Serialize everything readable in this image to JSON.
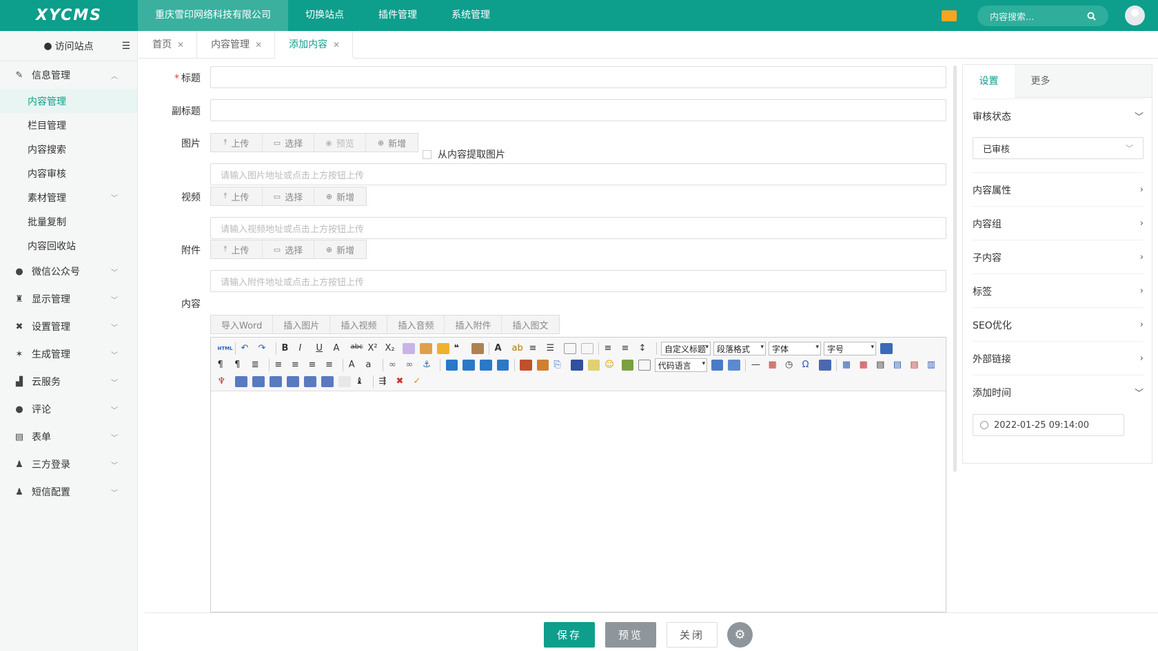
{
  "header": {
    "logo": "XYCMS",
    "nav": [
      "重庆雪印网络科技有限公司",
      "切换站点",
      "插件管理",
      "系统管理"
    ],
    "search_placeholder": "内容搜索...",
    "search_icon": "search-icon"
  },
  "sidebar": {
    "visit": "访问站点",
    "groups": [
      {
        "label": "信息管理",
        "icon": "edit-icon"
      },
      {
        "label": "微信公众号",
        "icon": "wechat-icon"
      },
      {
        "label": "显示管理",
        "icon": "shirt-icon"
      },
      {
        "label": "设置管理",
        "icon": "wrench-icon"
      },
      {
        "label": "生成管理",
        "icon": "magic-icon"
      },
      {
        "label": "云服务",
        "icon": "signal-icon"
      },
      {
        "label": "评论",
        "icon": "comment-icon"
      },
      {
        "label": "表单",
        "icon": "form-icon"
      },
      {
        "label": "三方登录",
        "icon": "user-icon"
      },
      {
        "label": "短信配置",
        "icon": "user-icon"
      }
    ],
    "sub": [
      "内容管理",
      "栏目管理",
      "内容搜索",
      "内容审核",
      "素材管理",
      "批量复制",
      "内容回收站"
    ]
  },
  "tabs": [
    "首页",
    "内容管理",
    "添加内容"
  ],
  "form": {
    "title_label": "标题",
    "subtitle_label": "副标题",
    "image_label": "图片",
    "video_label": "视频",
    "attach_label": "附件",
    "content_label": "内容",
    "btn_upload": "上传",
    "btn_select": "选择",
    "btn_preview": "预览",
    "btn_new": "新增",
    "extract_image": "从内容提取图片",
    "image_placeholder": "请输入图片地址或点击上方按钮上传",
    "video_placeholder": "请输入视频地址或点击上方按钮上传",
    "attach_placeholder": "请输入附件地址或点击上方按钮上传",
    "content_tools": [
      "导入Word",
      "插入图片",
      "插入视频",
      "插入音频",
      "插入附件",
      "插入图文"
    ]
  },
  "editor": {
    "selects": [
      "自定义标题",
      "段落格式",
      "字体",
      "字号",
      "代码语言"
    ]
  },
  "settings": {
    "tabs": [
      "设置",
      "更多"
    ],
    "audit_label": "审核状态",
    "audit_value": "已审核",
    "sections": [
      "内容属性",
      "内容组",
      "子内容",
      "标签",
      "SEO优化",
      "外部链接"
    ],
    "add_time_label": "添加时间",
    "add_time_value": "2022-01-25 09:14:00"
  },
  "footer": {
    "save": "保存",
    "preview": "预览",
    "close": "关闭"
  }
}
